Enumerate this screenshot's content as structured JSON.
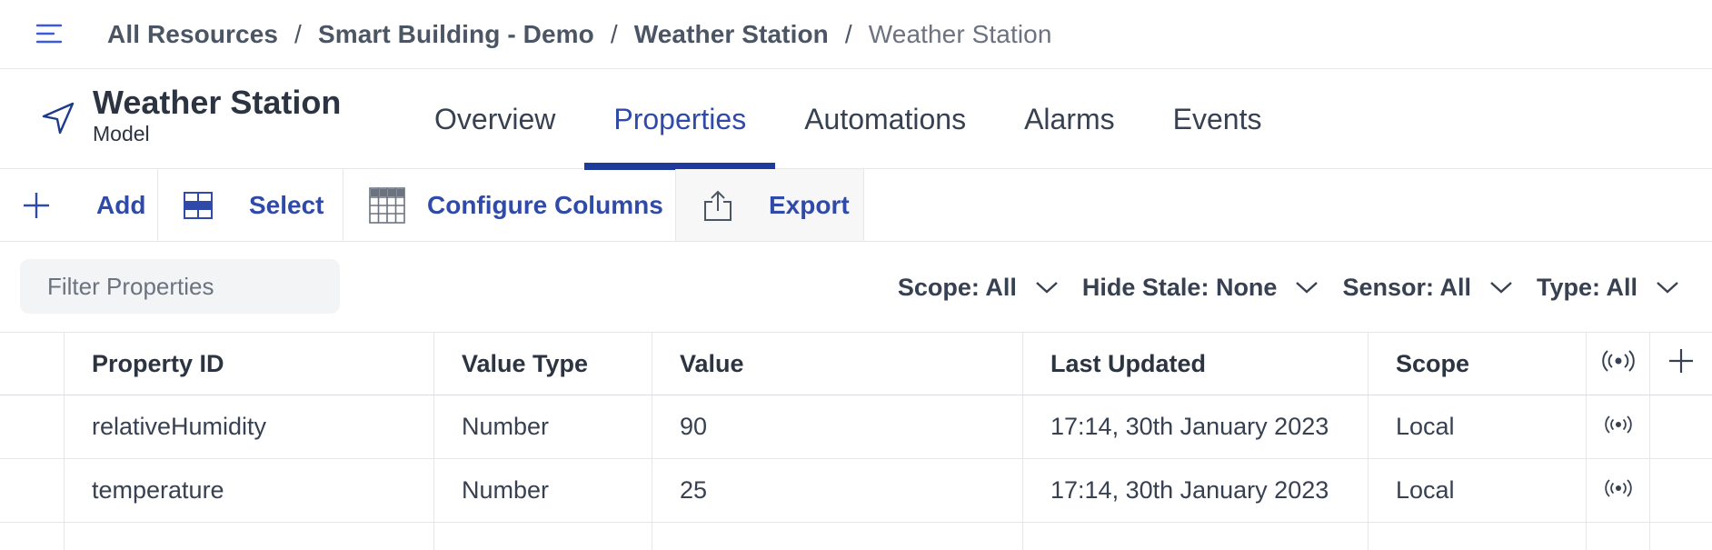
{
  "breadcrumb": {
    "items": [
      "All Resources",
      "Smart Building - Demo",
      "Weather Station",
      "Weather Station"
    ],
    "separator": "/"
  },
  "header": {
    "title": "Weather Station",
    "subtitle": "Model",
    "icon": "navigation-arrow-icon"
  },
  "tabs": [
    {
      "label": "Overview",
      "active": false
    },
    {
      "label": "Properties",
      "active": true
    },
    {
      "label": "Automations",
      "active": false
    },
    {
      "label": "Alarms",
      "active": false
    },
    {
      "label": "Events",
      "active": false
    }
  ],
  "toolbar": {
    "add_label": "Add",
    "select_label": "Select",
    "configure_label": "Configure Columns",
    "export_label": "Export"
  },
  "filter": {
    "placeholder": "Filter Properties",
    "value": ""
  },
  "dropdowns": {
    "scope": "Scope: All",
    "hide_stale": "Hide Stale: None",
    "sensor": "Sensor: All",
    "type": "Type: All"
  },
  "table": {
    "headers": {
      "property_id": "Property ID",
      "value_type": "Value Type",
      "value": "Value",
      "last_updated": "Last Updated",
      "scope": "Scope"
    },
    "rows": [
      {
        "property_id": "relativeHumidity",
        "value_type": "Number",
        "value": "90",
        "last_updated": "17:14, 30th January 2023",
        "scope": "Local",
        "sensor_icon": "broadcast-icon"
      },
      {
        "property_id": "temperature",
        "value_type": "Number",
        "value": "25",
        "last_updated": "17:14, 30th January 2023",
        "scope": "Local",
        "sensor_icon": "broadcast-icon"
      }
    ]
  },
  "colors": {
    "accent": "#2f4aa8",
    "tab_underline": "#1e3a9a",
    "text": "#374151",
    "border": "#e5e7eb"
  }
}
